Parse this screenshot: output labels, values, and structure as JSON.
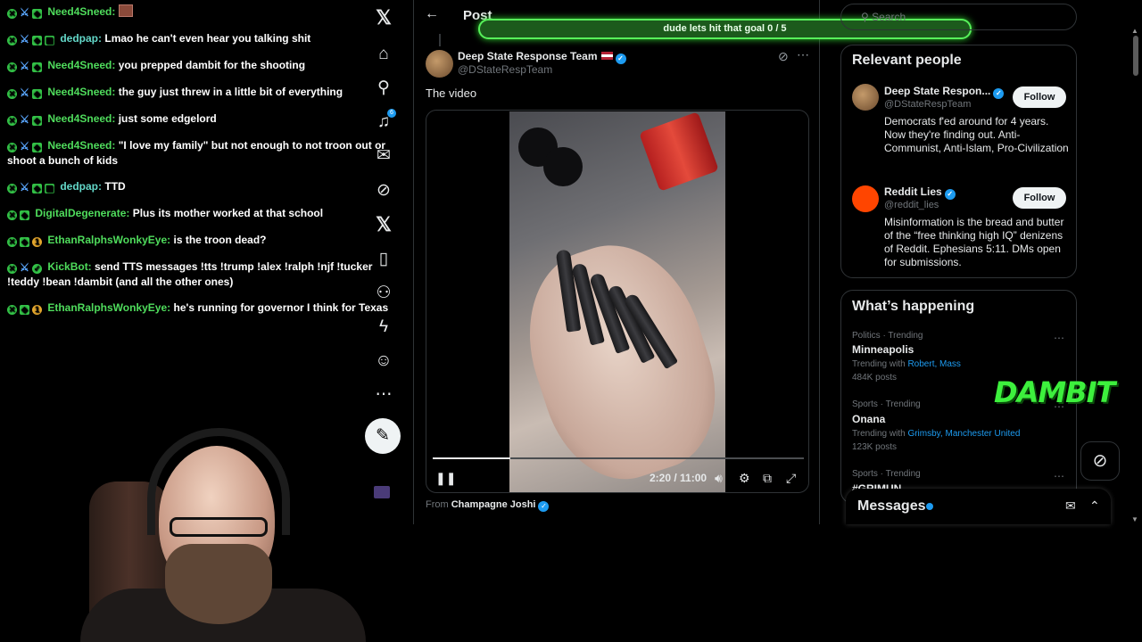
{
  "chat": {
    "lines": [
      {
        "user": "Need4Sneed:",
        "text": "",
        "emote": true
      },
      {
        "user": "dedpap:",
        "text": "Lmao he can't even hear you talking shit"
      },
      {
        "user": "Need4Sneed:",
        "text": "you prepped dambit for the shooting"
      },
      {
        "user": "Need4Sneed:",
        "text": "the guy just threw in a little bit of everything"
      },
      {
        "user": "Need4Sneed:",
        "text": "just some edgelord"
      },
      {
        "user": "Need4Sneed:",
        "text": "\"I love my family\" but not enough to not troon out or shoot a bunch of kids"
      },
      {
        "user": "dedpap:",
        "text": "TTD"
      },
      {
        "user": "DigitalDegenerate:",
        "text": "Plus its mother worked at that school"
      },
      {
        "user": "EthanRalphsWonkyEye:",
        "text": "is the troon dead?"
      },
      {
        "user": "KickBot:",
        "text": "send TTS messages !tts !trump !alex !ralph !njf !tucker !teddy !bean !dambit (and all the other ones)"
      },
      {
        "user": "EthanRalphsWonkyEye:",
        "text": "he's running for governor I think for Texas"
      }
    ]
  },
  "rail": {
    "icons": [
      "x-logo-icon",
      "home-icon",
      "explore-icon",
      "notifications-icon",
      "messages-icon",
      "grok-icon",
      "x-premium-icon",
      "bookmarks-icon",
      "communities-icon",
      "verified-orgs-icon",
      "profile-icon",
      "more-icon"
    ],
    "notification_count": "6"
  },
  "goal_bar": {
    "text": "dude lets hit that goal 0 / 5"
  },
  "post": {
    "heading": "Post",
    "author_name": "Deep State Response Team",
    "author_handle": "@DStateRespTeam",
    "text": "The video",
    "video": {
      "current_time": "2:20",
      "duration": "11:00",
      "time_readout": "2:20 / 11:00",
      "progress": 0.21
    },
    "from_label": "From",
    "from_name": "Champagne Joshi"
  },
  "sidebar": {
    "search_placeholder": "Search",
    "relevant_title": "Relevant people",
    "people": [
      {
        "name": "Deep State Respon...",
        "handle": "@DStateRespTeam",
        "bio": "Democrats f'ed around for 4 years. Now they're finding out. Anti-Communist, Anti-Islam, Pro-Civilization",
        "follow": "Follow"
      },
      {
        "name": "Reddit Lies",
        "handle": "@reddit_lies",
        "bio": "Misinformation is the bread and butter of the “free thinking high IQ” denizens of Reddit. Ephesians 5:11. DMs open for submissions.",
        "follow": "Follow"
      }
    ],
    "happening_title": "What’s happening",
    "trends": [
      {
        "meta": "Politics · Trending",
        "name": "Minneapolis",
        "with_label": "Trending with",
        "with_links": "Robert, Mass",
        "count": "484K posts"
      },
      {
        "meta": "Sports · Trending",
        "name": "Onana",
        "with_label": "Trending with",
        "with_links": "Grimsby, Manchester United",
        "count": "123K posts"
      },
      {
        "meta": "Sports · Trending",
        "name": "#GRIMUN"
      }
    ],
    "messages_title": "Messages"
  },
  "overlay": {
    "dambit_text": "DAMBIT"
  },
  "colors": {
    "accent": "#1d9bf0",
    "goal_green": "#57f05a",
    "chat_username": "#4fdc5c"
  }
}
